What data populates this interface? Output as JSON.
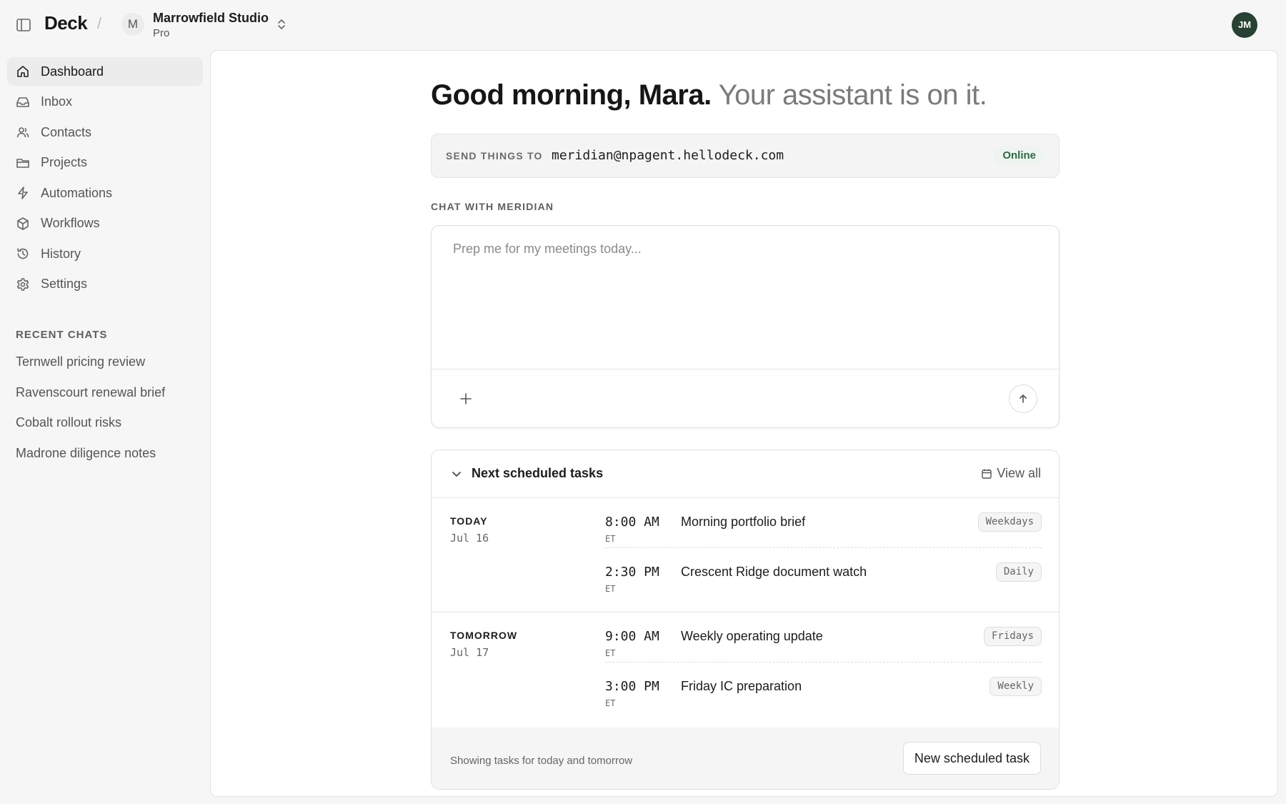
{
  "header": {
    "brand": "Deck",
    "separator": "/",
    "workspace": {
      "initial": "M",
      "name": "Marrowfield Studio",
      "plan": "Pro"
    },
    "user_initials": "JM"
  },
  "sidebar": {
    "items": [
      {
        "label": "Dashboard",
        "icon": "home-icon",
        "active": true
      },
      {
        "label": "Inbox",
        "icon": "inbox-icon"
      },
      {
        "label": "Contacts",
        "icon": "users-icon"
      },
      {
        "label": "Projects",
        "icon": "folder-icon"
      },
      {
        "label": "Automations",
        "icon": "bolt-icon"
      },
      {
        "label": "Workflows",
        "icon": "box-icon"
      },
      {
        "label": "History",
        "icon": "history-icon"
      },
      {
        "label": "Settings",
        "icon": "gear-icon"
      }
    ],
    "recent_heading": "RECENT CHATS",
    "recent_chats": [
      "Ternwell pricing review",
      "Ravenscourt renewal brief",
      "Cobalt rollout risks",
      "Madrone diligence notes"
    ]
  },
  "main": {
    "greeting_strong": "Good morning, Mara.",
    "greeting_soft": "Your assistant is on it.",
    "send": {
      "label": "SEND THINGS TO",
      "email": "meridian@npagent.hellodeck.com",
      "status": "Online"
    },
    "chat": {
      "heading": "CHAT WITH MERIDIAN",
      "placeholder": "Prep me for my meetings today..."
    },
    "tasks": {
      "title": "Next scheduled tasks",
      "view_all": "View all",
      "groups": [
        {
          "label": "TODAY",
          "date": "Jul 16",
          "items": [
            {
              "time": "8:00 AM",
              "tz": "ET",
              "name": "Morning portfolio brief",
              "freq": "Weekdays"
            },
            {
              "time": "2:30 PM",
              "tz": "ET",
              "name": "Crescent Ridge document watch",
              "freq": "Daily"
            }
          ]
        },
        {
          "label": "TOMORROW",
          "date": "Jul 17",
          "items": [
            {
              "time": "9:00 AM",
              "tz": "ET",
              "name": "Weekly operating update",
              "freq": "Fridays"
            },
            {
              "time": "3:00 PM",
              "tz": "ET",
              "name": "Friday IC preparation",
              "freq": "Weekly"
            }
          ]
        }
      ],
      "footer_text": "Showing tasks for today and tomorrow",
      "new_task_label": "New scheduled task"
    }
  },
  "colors": {
    "page_bg": "#f6f6f6",
    "panel_bg": "#ffffff",
    "avatar_bg": "#274233",
    "online_text": "#2c6a43",
    "online_bg": "#eef4ef"
  }
}
